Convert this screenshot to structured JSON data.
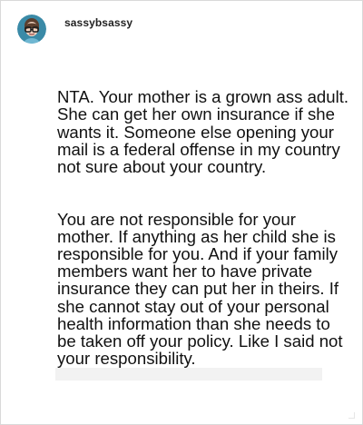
{
  "post": {
    "username": "sassybsassy",
    "avatar_icon": "cartoon-avatar-with-glasses-icon",
    "paragraphs": [
      "NTA. Your mother is a grown ass adult. She can get her own insurance if she wants it. Someone else opening your mail is a federal offense in my country not sure about your country.",
      "You are not responsible for your mother. If anything as her child she is responsible for you. And if your family members want her to have private insurance they can put her in theirs. If she cannot stay out of your personal health information than she needs to be taken off your policy. Like I said not your responsibility."
    ]
  },
  "colors": {
    "text": "#111111",
    "username": "#222222",
    "border": "#d9d9d9",
    "avatar_bg": "#3a8aa7",
    "avatar_glasses": "#1b1b1b",
    "avatar_skin": "#f1d2bf"
  }
}
